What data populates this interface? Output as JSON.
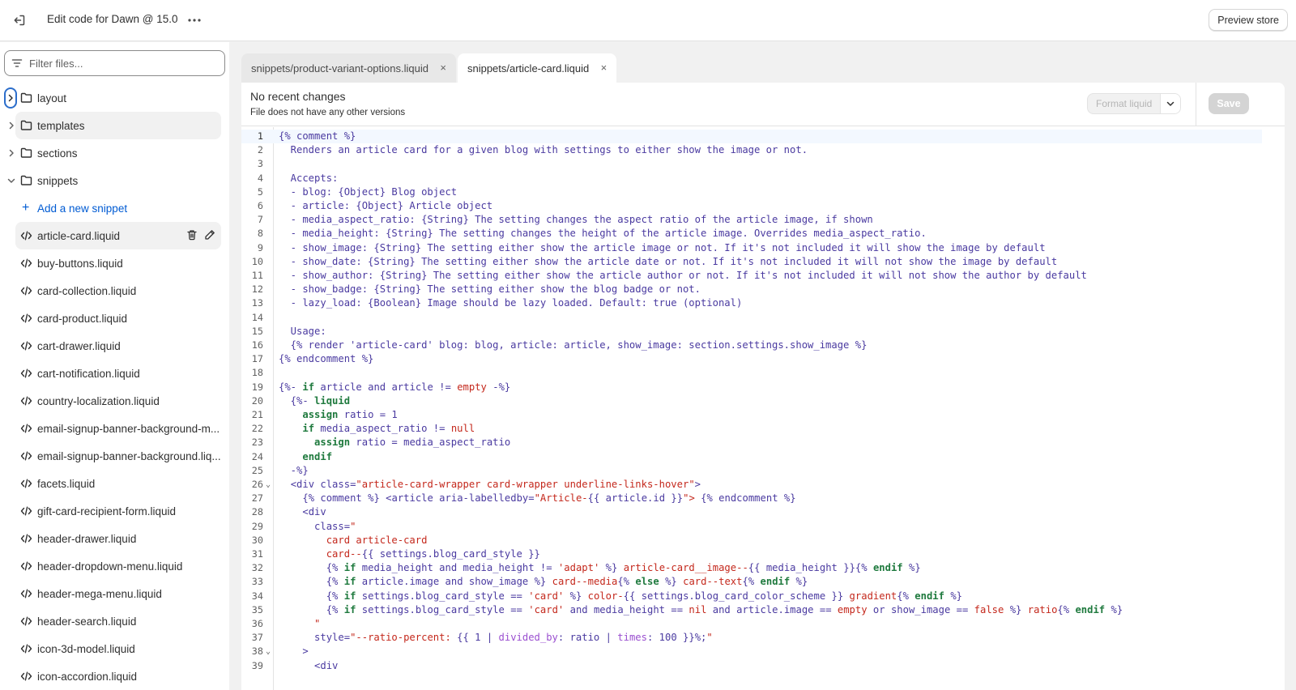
{
  "topbar": {
    "title": "Edit code for Dawn @ 15.0",
    "preview_label": "Preview store"
  },
  "sidebar": {
    "filter_placeholder": "Filter files...",
    "folders": [
      "layout",
      "templates",
      "sections",
      "snippets"
    ],
    "add_snippet_label": "Add a new snippet",
    "files": [
      "article-card.liquid",
      "buy-buttons.liquid",
      "card-collection.liquid",
      "card-product.liquid",
      "cart-drawer.liquid",
      "cart-notification.liquid",
      "country-localization.liquid",
      "email-signup-banner-background-m...",
      "email-signup-banner-background.liq...",
      "facets.liquid",
      "gift-card-recipient-form.liquid",
      "header-drawer.liquid",
      "header-dropdown-menu.liquid",
      "header-mega-menu.liquid",
      "header-search.liquid",
      "icon-3d-model.liquid",
      "icon-accordion.liquid"
    ]
  },
  "tabs": [
    {
      "label": "snippets/product-variant-options.liquid",
      "close": "×"
    },
    {
      "label": "snippets/article-card.liquid",
      "close": "×"
    }
  ],
  "editor_header": {
    "title": "No recent changes",
    "subtitle": "File does not have any other versions",
    "format_label": "Format liquid",
    "save_label": "Save"
  },
  "code_lines": [
    "{% comment %}",
    "  Renders an article card for a given blog with settings to either show the image or not.",
    "",
    "  Accepts:",
    "  - blog: {Object} Blog object",
    "  - article: {Object} Article object",
    "  - media_aspect_ratio: {String} The setting changes the aspect ratio of the article image, if shown",
    "  - media_height: {String} The setting changes the height of the article image. Overrides media_aspect_ratio.",
    "  - show_image: {String} The setting either show the article image or not. If it's not included it will show the image by default",
    "  - show_date: {String} The setting either show the article date or not. If it's not included it will not show the image by default",
    "  - show_author: {String} The setting either show the article author or not. If it's not included it will not show the author by default",
    "  - show_badge: {String} The setting either show the blog badge or not.",
    "  - lazy_load: {Boolean} Image should be lazy loaded. Default: true (optional)",
    "",
    "  Usage:",
    "  {% render 'article-card' blog: blog, article: article, show_image: section.settings.show_image %}",
    "{% endcomment %}",
    "",
    "{%- if article and article != empty -%}",
    "  {%- liquid",
    "    assign ratio = 1",
    "    if media_aspect_ratio != null",
    "      assign ratio = media_aspect_ratio",
    "    endif",
    "  -%}",
    "  <div class=\"article-card-wrapper card-wrapper underline-links-hover\">",
    "    {% comment %} <article aria-labelledby=\"Article-{{ article.id }}\"> {% endcomment %}",
    "    <div",
    "      class=\"",
    "        card article-card",
    "        card--{{ settings.blog_card_style }}",
    "        {% if media_height and media_height != 'adapt' %} article-card__image--{{ media_height }}{% endif %}",
    "        {% if article.image and show_image %} card--media{% else %} card--text{% endif %}",
    "        {% if settings.blog_card_style == 'card' %} color-{{ settings.blog_card_color_scheme }} gradient{% endif %}",
    "        {% if settings.blog_card_style == 'card' and media_height == nil and article.image == empty or show_image == false %} ratio{% endif %}",
    "      \"",
    "      style=\"--ratio-percent: {{ 1 | divided_by: ratio | times: 100 }}%;\"",
    "    >",
    "      <div"
  ]
}
